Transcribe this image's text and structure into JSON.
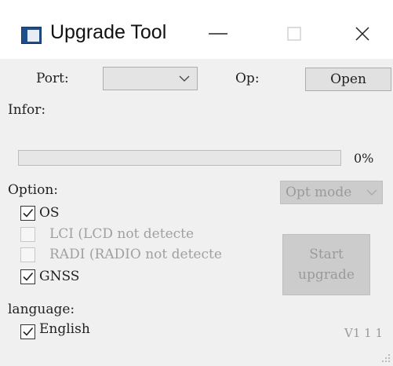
{
  "window": {
    "title": "Upgrade Tool",
    "icon": "app-window-icon",
    "controls": [
      "minimize-icon",
      "maximize-icon",
      "close-icon"
    ]
  },
  "connection": {
    "port_label": "Port:",
    "port_value": "",
    "op_label": "Op:",
    "open_button": "Open"
  },
  "info": {
    "label": "Infor:"
  },
  "progress": {
    "value": 0,
    "text": "0%"
  },
  "options": {
    "label": "Option:",
    "mode_select": "Opt mode",
    "items": [
      {
        "label": "OS",
        "checked": true,
        "enabled": true
      },
      {
        "label": "LCI (LCD not detecte",
        "checked": false,
        "enabled": false
      },
      {
        "label": "RADI (RADIO not detecte",
        "checked": false,
        "enabled": false
      },
      {
        "label": "GNSS",
        "checked": true,
        "enabled": true
      }
    ],
    "start_button_line1": "Start",
    "start_button_line2": "upgrade"
  },
  "language": {
    "label": "language:",
    "english_label": "English",
    "english_checked": true
  },
  "version": "V1 1 1"
}
